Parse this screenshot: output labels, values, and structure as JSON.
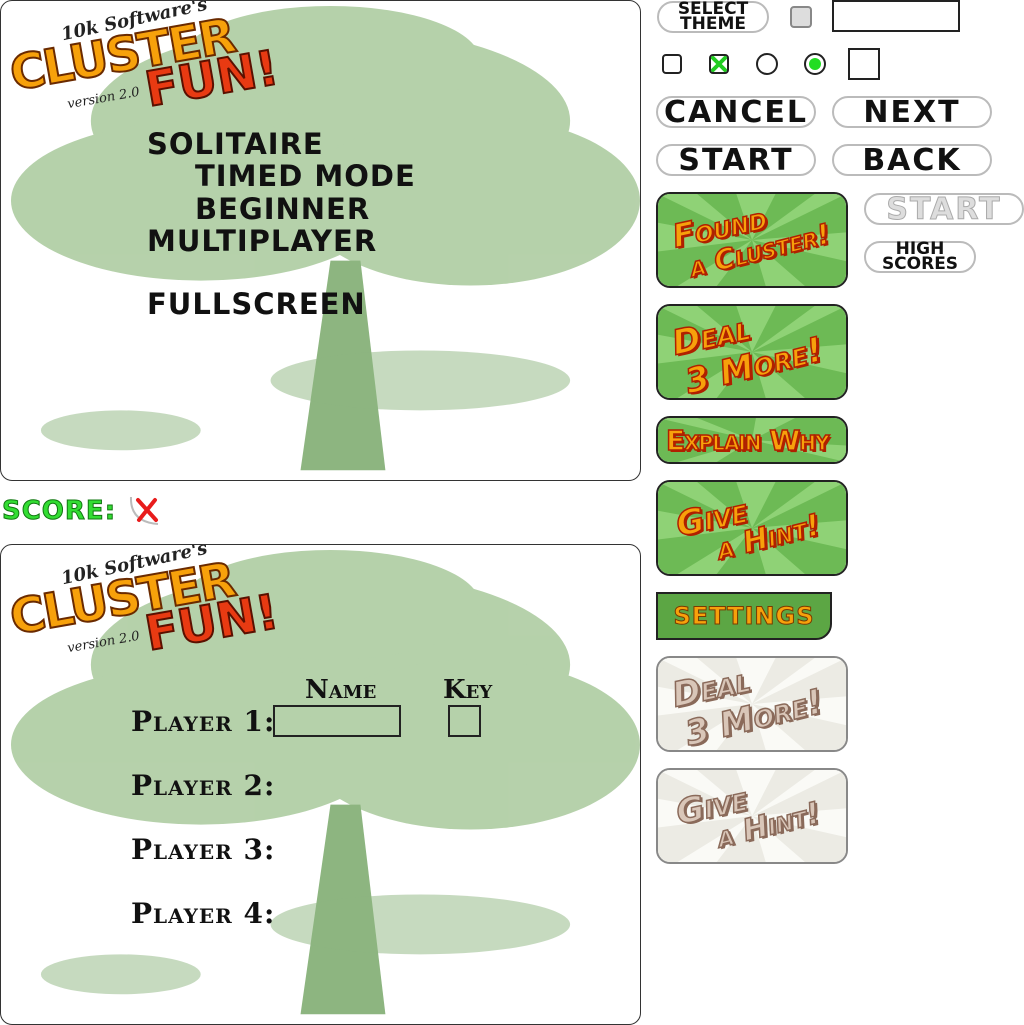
{
  "logo": {
    "publisher": "10k Software's",
    "word1": "CLUSTER",
    "word2": "FUN!",
    "version": "version 2.0"
  },
  "main_menu": {
    "items": [
      "SOLITAIRE",
      "TIMED MODE",
      "BEGINNER",
      "MULTIPLAYER",
      "FULLSCREEN"
    ]
  },
  "score": {
    "label": "SCORE:"
  },
  "players": {
    "name_header": "Name",
    "key_header": "Key",
    "labels": [
      "Player 1:",
      "Player 2:",
      "Player 3:",
      "Player 4:"
    ]
  },
  "buttons": {
    "select_theme": "SELECT\nTHEME",
    "select_theme_l1": "SELECT",
    "select_theme_l2": "THEME",
    "cancel": "CANCEL",
    "next": "NEXT",
    "start": "START",
    "back": "BACK",
    "start_disabled": "START",
    "high_scores_l1": "HIGH",
    "high_scores_l2": "SCORES",
    "found_cluster_l1": "Found",
    "found_cluster_l2": "a Cluster!",
    "deal_more_l1": "Deal",
    "deal_more_l2": "3 More!",
    "explain_why": "Explain Why",
    "give_hint_l1": "Give",
    "give_hint_l2": "a Hint!",
    "settings": "SETTINGS",
    "deal_more_disabled_l1": "Deal",
    "deal_more_disabled_l2": "3 More!",
    "give_hint_disabled_l1": "Give",
    "give_hint_disabled_l2": "a Hint!"
  },
  "colors": {
    "button_green": "#6dba55",
    "button_text": "#f7a10b",
    "button_outline": "#b02000",
    "score_green": "#33dd33",
    "tree": "#8db580"
  }
}
